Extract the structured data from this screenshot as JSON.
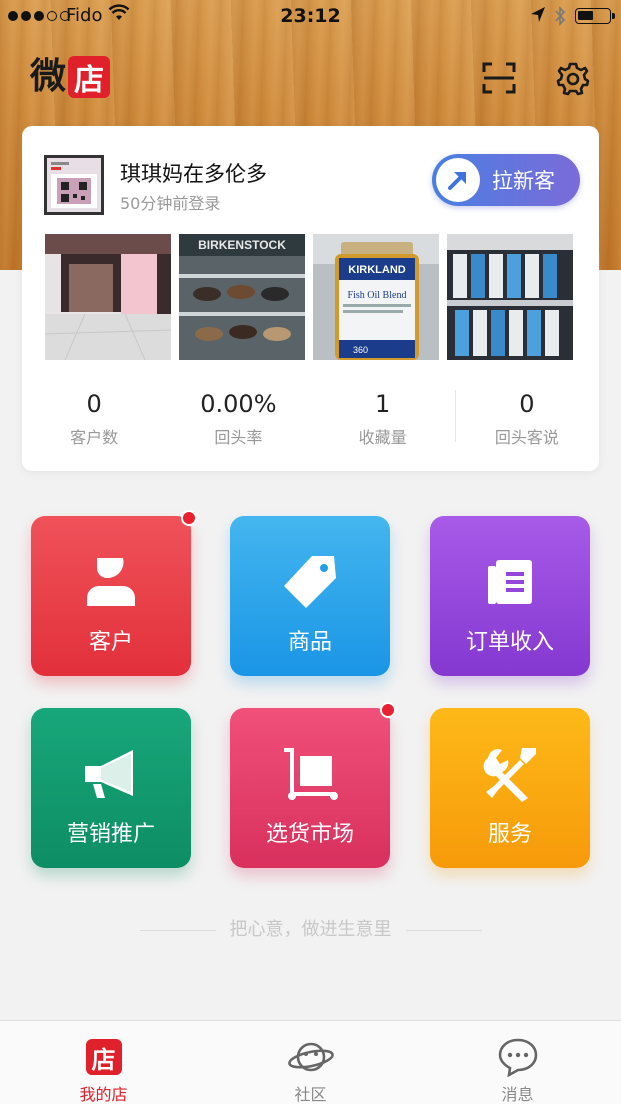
{
  "status_bar": {
    "carrier": "Fido",
    "time": "23:12",
    "signal_bars": 3,
    "battery_level": 0.45
  },
  "header": {
    "logo_text": "微",
    "logo_badge": "店",
    "icons": [
      "scan-icon",
      "gear-icon"
    ]
  },
  "profile": {
    "store_name": "琪琪妈在多伦多",
    "last_login": "50分钟前登录",
    "invite_label": "拉新客"
  },
  "photos": [
    {
      "caption": ""
    },
    {
      "caption": "BIRKENSTOCK"
    },
    {
      "caption": "KIRKLAND",
      "sub": "Fish Oil Blend",
      "count": "360"
    },
    {
      "caption": ""
    }
  ],
  "stats": [
    {
      "value": "0",
      "label": "客户数"
    },
    {
      "value": "0.00%",
      "label": "回头率"
    },
    {
      "value": "1",
      "label": "收藏量"
    },
    {
      "value": "0",
      "label": "回头客说"
    }
  ],
  "tiles": [
    {
      "label": "客户",
      "icon": "person-icon",
      "color": "#e2303b",
      "badge": true
    },
    {
      "label": "商品",
      "icon": "price-tag-icon",
      "color": "#1a95e6",
      "badge": false
    },
    {
      "label": "订单收入",
      "icon": "ledger-icon",
      "color": "#8438d0",
      "badge": false
    },
    {
      "label": "营销推广",
      "icon": "megaphone-icon",
      "color": "#0e8d64",
      "badge": false
    },
    {
      "label": "选货市场",
      "icon": "cart-box-icon",
      "color": "#d9305e",
      "badge": true
    },
    {
      "label": "服务",
      "icon": "tools-icon",
      "color": "#f79a0a",
      "badge": false
    }
  ],
  "slogan": "把心意，做进生意里",
  "tabbar": [
    {
      "label": "我的店",
      "icon": "store-icon",
      "active": true,
      "icon_text": "店"
    },
    {
      "label": "社区",
      "icon": "planet-icon",
      "active": false
    },
    {
      "label": "消息",
      "icon": "chat-icon",
      "active": false
    }
  ],
  "colors": {
    "brand_red": "#e0202a",
    "accent_blue": "#4a7fe2",
    "muted_text": "#999999"
  }
}
